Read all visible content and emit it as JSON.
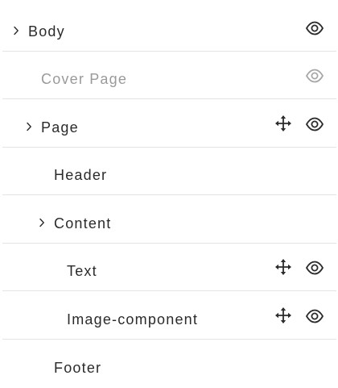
{
  "layers": [
    {
      "label": "Body",
      "expandable": true,
      "muted": false,
      "movable": false,
      "visible_icon": "eye-icon"
    },
    {
      "label": "Cover Page",
      "expandable": false,
      "muted": true,
      "movable": false,
      "visible_icon": "eye-icon-muted"
    },
    {
      "label": "Page",
      "expandable": true,
      "muted": false,
      "movable": true,
      "visible_icon": "eye-icon"
    },
    {
      "label": "Header",
      "expandable": false,
      "muted": false,
      "movable": false,
      "visible_icon": null
    },
    {
      "label": "Content",
      "expandable": true,
      "muted": false,
      "movable": false,
      "visible_icon": null
    },
    {
      "label": "Text",
      "expandable": false,
      "muted": false,
      "movable": true,
      "visible_icon": "eye-icon"
    },
    {
      "label": "Image-component",
      "expandable": false,
      "muted": false,
      "movable": true,
      "visible_icon": "eye-icon"
    },
    {
      "label": "Footer",
      "expandable": false,
      "muted": false,
      "movable": false,
      "visible_icon": null
    }
  ],
  "colors": {
    "text": "#2b2b2b",
    "muted_text": "#9a9a9a",
    "icon": "#2b2b2b",
    "muted_icon": "#a8a8a8",
    "divider": "#e4e4e4"
  }
}
